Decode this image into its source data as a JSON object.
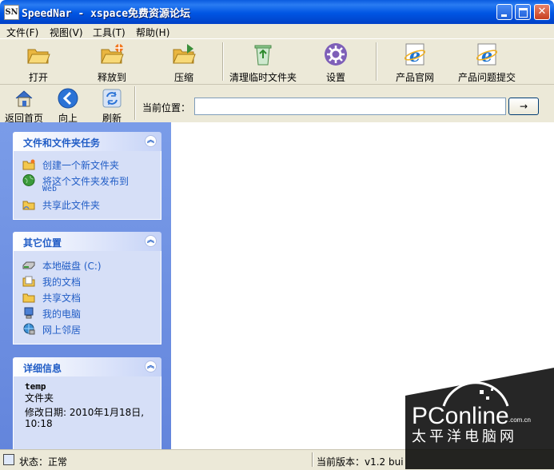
{
  "window": {
    "app_icon_text": "SN",
    "title": "SpeedNar - xspace免费资源论坛",
    "min_label": "minimize",
    "max_label": "maximize",
    "close_glyph": "✕"
  },
  "menu": [
    "文件(F)",
    "视图(V)",
    "工具(T)",
    "帮助(H)"
  ],
  "toolbar": {
    "open": "打开",
    "release": "释放到",
    "compress": "压缩",
    "clean_temp": "清理临时文件夹",
    "settings": "设置",
    "product_site": "产品官网",
    "product_issue": "产品问题提交"
  },
  "nav": {
    "home": "返回首页",
    "up": "向上",
    "refresh": "刷新",
    "address_label": "当前位置：",
    "address_value": "",
    "go": "→"
  },
  "tasks_panel": {
    "title": "文件和文件夹任务",
    "items": [
      "创建一个新文件夹",
      "将这个文件夹发布到",
      "Web",
      "共享此文件夹"
    ]
  },
  "places_panel": {
    "title": "其它位置",
    "items": [
      "本地磁盘 (C:)",
      "我的文档",
      "共享文档",
      "我的电脑",
      "网上邻居"
    ]
  },
  "details_panel": {
    "title": "详细信息",
    "name": "temp",
    "type": "文件夹",
    "modified": "修改日期: 2010年1月18日,",
    "modified_time": "10:18"
  },
  "status": {
    "text": "状态：正常",
    "version": "当前版本：v1.2 bui"
  },
  "watermark": {
    "brand": "PConline",
    "domain": ".com.cn",
    "slogan": "太平洋电脑网"
  },
  "colors": {
    "titlebar": "#0055e3",
    "task_link": "#215dc6",
    "sidebar": "#6f93e0",
    "panel_body": "#d6dff7"
  }
}
